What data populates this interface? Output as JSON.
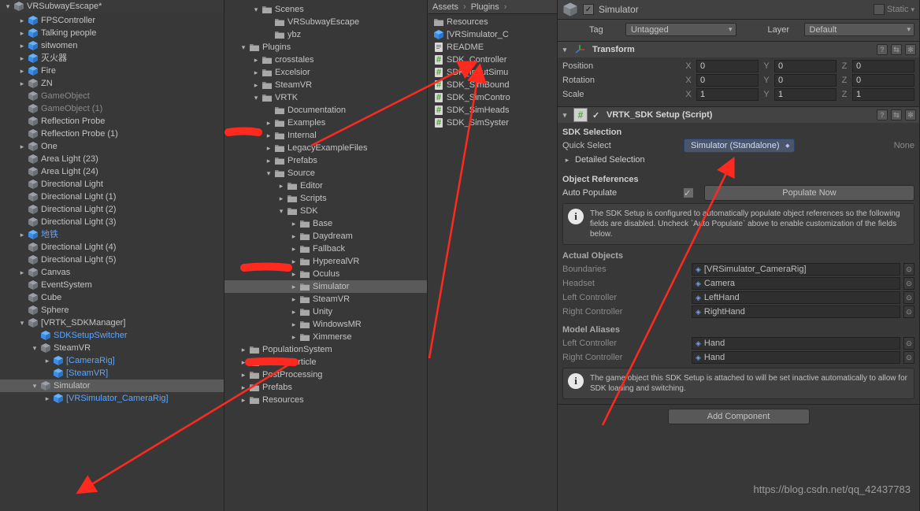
{
  "hierarchy": {
    "scene_name": "VRSubwayEscape*",
    "items": [
      {
        "label": "FPSController",
        "depth": 1,
        "arrow": "collapsed",
        "icon": "cube-blue"
      },
      {
        "label": "Talking people",
        "depth": 1,
        "arrow": "collapsed",
        "icon": "cube-blue"
      },
      {
        "label": "sitwomen",
        "depth": 1,
        "arrow": "collapsed",
        "icon": "cube-blue"
      },
      {
        "label": "灭火器",
        "depth": 1,
        "arrow": "collapsed",
        "icon": "cube-blue"
      },
      {
        "label": "Fire",
        "depth": 1,
        "arrow": "collapsed",
        "icon": "cube-blue"
      },
      {
        "label": "ZN",
        "depth": 1,
        "arrow": "collapsed",
        "icon": "cube"
      },
      {
        "label": "GameObject",
        "depth": 1,
        "arrow": "none",
        "icon": "cube",
        "dim": true
      },
      {
        "label": "GameObject (1)",
        "depth": 1,
        "arrow": "none",
        "icon": "cube",
        "dim": true
      },
      {
        "label": "Reflection Probe",
        "depth": 1,
        "arrow": "none",
        "icon": "cube"
      },
      {
        "label": "Reflection Probe (1)",
        "depth": 1,
        "arrow": "none",
        "icon": "cube"
      },
      {
        "label": "One",
        "depth": 1,
        "arrow": "collapsed",
        "icon": "cube"
      },
      {
        "label": "Area Light (23)",
        "depth": 1,
        "arrow": "none",
        "icon": "cube"
      },
      {
        "label": "Area Light (24)",
        "depth": 1,
        "arrow": "none",
        "icon": "cube"
      },
      {
        "label": "Directional Light",
        "depth": 1,
        "arrow": "none",
        "icon": "cube"
      },
      {
        "label": "Directional Light (1)",
        "depth": 1,
        "arrow": "none",
        "icon": "cube"
      },
      {
        "label": "Directional Light (2)",
        "depth": 1,
        "arrow": "none",
        "icon": "cube"
      },
      {
        "label": "Directional Light (3)",
        "depth": 1,
        "arrow": "none",
        "icon": "cube"
      },
      {
        "label": "地铁",
        "depth": 1,
        "arrow": "collapsed",
        "icon": "cube-blue",
        "blue": true
      },
      {
        "label": "Directional Light (4)",
        "depth": 1,
        "arrow": "none",
        "icon": "cube"
      },
      {
        "label": "Directional Light (5)",
        "depth": 1,
        "arrow": "none",
        "icon": "cube"
      },
      {
        "label": "Canvas",
        "depth": 1,
        "arrow": "collapsed",
        "icon": "cube"
      },
      {
        "label": "EventSystem",
        "depth": 1,
        "arrow": "none",
        "icon": "cube"
      },
      {
        "label": "Cube",
        "depth": 1,
        "arrow": "none",
        "icon": "cube"
      },
      {
        "label": "Sphere",
        "depth": 1,
        "arrow": "none",
        "icon": "cube"
      },
      {
        "label": "[VRTK_SDKManager]",
        "depth": 1,
        "arrow": "open",
        "icon": "cube"
      },
      {
        "label": "SDKSetupSwitcher",
        "depth": 2,
        "arrow": "none",
        "icon": "cube-blue",
        "blue": true
      },
      {
        "label": "SteamVR",
        "depth": 2,
        "arrow": "open",
        "icon": "cube"
      },
      {
        "label": "[CameraRig]",
        "depth": 3,
        "arrow": "collapsed",
        "icon": "cube-blue",
        "blue": true
      },
      {
        "label": "[SteamVR]",
        "depth": 3,
        "arrow": "none",
        "icon": "cube-blue",
        "blue": true
      },
      {
        "label": "Simulator",
        "depth": 2,
        "arrow": "open",
        "icon": "cube",
        "sel": true
      },
      {
        "label": "[VRSimulator_CameraRig]",
        "depth": 3,
        "arrow": "collapsed",
        "icon": "cube-blue",
        "blue": true
      }
    ]
  },
  "project": {
    "root": "Scenes",
    "items": [
      {
        "label": "Scenes",
        "depth": 2,
        "arrow": "open",
        "icon": "folder"
      },
      {
        "label": "VRSubwayEscape",
        "depth": 3,
        "arrow": "none",
        "icon": "folder"
      },
      {
        "label": "ybz",
        "depth": 3,
        "arrow": "none",
        "icon": "folder"
      },
      {
        "label": "Plugins",
        "depth": 1,
        "arrow": "open",
        "icon": "folder"
      },
      {
        "label": "crosstales",
        "depth": 2,
        "arrow": "collapsed",
        "icon": "folder"
      },
      {
        "label": "Excelsior",
        "depth": 2,
        "arrow": "collapsed",
        "icon": "folder"
      },
      {
        "label": "SteamVR",
        "depth": 2,
        "arrow": "collapsed",
        "icon": "folder"
      },
      {
        "label": "VRTK",
        "depth": 2,
        "arrow": "open",
        "icon": "folder"
      },
      {
        "label": "Documentation",
        "depth": 3,
        "arrow": "none",
        "icon": "folder"
      },
      {
        "label": "Examples",
        "depth": 3,
        "arrow": "collapsed",
        "icon": "folder"
      },
      {
        "label": "Internal",
        "depth": 3,
        "arrow": "collapsed",
        "icon": "folder"
      },
      {
        "label": "LegacyExampleFiles",
        "depth": 3,
        "arrow": "collapsed",
        "icon": "folder"
      },
      {
        "label": "Prefabs",
        "depth": 3,
        "arrow": "collapsed",
        "icon": "folder"
      },
      {
        "label": "Source",
        "depth": 3,
        "arrow": "open",
        "icon": "folder"
      },
      {
        "label": "Editor",
        "depth": 4,
        "arrow": "collapsed",
        "icon": "folder"
      },
      {
        "label": "Scripts",
        "depth": 4,
        "arrow": "collapsed",
        "icon": "folder"
      },
      {
        "label": "SDK",
        "depth": 4,
        "arrow": "open",
        "icon": "folder"
      },
      {
        "label": "Base",
        "depth": 5,
        "arrow": "collapsed",
        "icon": "folder"
      },
      {
        "label": "Daydream",
        "depth": 5,
        "arrow": "collapsed",
        "icon": "folder"
      },
      {
        "label": "Fallback",
        "depth": 5,
        "arrow": "collapsed",
        "icon": "folder"
      },
      {
        "label": "HyperealVR",
        "depth": 5,
        "arrow": "collapsed",
        "icon": "folder"
      },
      {
        "label": "Oculus",
        "depth": 5,
        "arrow": "collapsed",
        "icon": "folder"
      },
      {
        "label": "Simulator",
        "depth": 5,
        "arrow": "collapsed",
        "icon": "folder",
        "sel": true
      },
      {
        "label": "SteamVR",
        "depth": 5,
        "arrow": "collapsed",
        "icon": "folder"
      },
      {
        "label": "Unity",
        "depth": 5,
        "arrow": "collapsed",
        "icon": "folder"
      },
      {
        "label": "WindowsMR",
        "depth": 5,
        "arrow": "collapsed",
        "icon": "folder"
      },
      {
        "label": "Ximmerse",
        "depth": 5,
        "arrow": "collapsed",
        "icon": "folder"
      },
      {
        "label": "PopulationSystem",
        "depth": 1,
        "arrow": "collapsed",
        "icon": "folder"
      },
      {
        "label": "Portal Particle",
        "depth": 1,
        "arrow": "collapsed",
        "icon": "folder"
      },
      {
        "label": "PostProcessing",
        "depth": 1,
        "arrow": "collapsed",
        "icon": "folder"
      },
      {
        "label": "Prefabs",
        "depth": 1,
        "arrow": "collapsed",
        "icon": "folder"
      },
      {
        "label": "Resources",
        "depth": 1,
        "arrow": "collapsed",
        "icon": "folder"
      }
    ]
  },
  "assets": {
    "crumb1": "Assets",
    "crumb2": "Plugins",
    "items": [
      {
        "label": "Resources",
        "icon": "folder"
      },
      {
        "label": "[VRSimulator_C",
        "icon": "prefab"
      },
      {
        "label": "README",
        "icon": "text"
      },
      {
        "label": "SDK_Controller",
        "icon": "script"
      },
      {
        "label": "SDK_InputSimu",
        "icon": "script"
      },
      {
        "label": "SDK_SimBound",
        "icon": "script"
      },
      {
        "label": "SDK_SimContro",
        "icon": "script"
      },
      {
        "label": "SDK_SimHeads",
        "icon": "script"
      },
      {
        "label": "SDK_SimSyster",
        "icon": "script"
      }
    ]
  },
  "inspector": {
    "go_name": "Simulator",
    "static_label": "Static",
    "tag_label": "Tag",
    "tag_value": "Untagged",
    "layer_label": "Layer",
    "layer_value": "Default",
    "transform": {
      "title": "Transform",
      "rows": [
        {
          "label": "Position",
          "x": "0",
          "y": "0",
          "z": "0"
        },
        {
          "label": "Rotation",
          "x": "0",
          "y": "0",
          "z": "0"
        },
        {
          "label": "Scale",
          "x": "1",
          "y": "1",
          "z": "1"
        }
      ]
    },
    "sdk": {
      "title": "VRTK_SDK Setup (Script)",
      "sel_title": "SDK Selection",
      "quick": "Quick Select",
      "quick_value": "Simulator (Standalone)",
      "none": "None",
      "detailed": "Detailed Selection",
      "obj_title": "Object References",
      "auto_pop": "Auto Populate",
      "btn_pop": "Populate Now",
      "msg1": "The SDK Setup is configured to automatically populate object references so the following fields are disabled. Uncheck `Auto Populate` above to enable customization of the fields below.",
      "actual": "Actual Objects",
      "rows": [
        {
          "label": "Boundaries",
          "val": "[VRSimulator_CameraRig]"
        },
        {
          "label": "Headset",
          "val": "Camera"
        },
        {
          "label": "Left Controller",
          "val": "LeftHand"
        },
        {
          "label": "Right Controller",
          "val": "RightHand"
        }
      ],
      "aliases": "Model Aliases",
      "arow": [
        {
          "label": "Left Controller",
          "val": "Hand"
        },
        {
          "label": "Right Controller",
          "val": "Hand"
        }
      ],
      "msg2": "The game object this SDK Setup is attached to will be set inactive automatically to allow for SDK loading and switching.",
      "addcomp": "Add Component"
    }
  },
  "watermark": "https://blog.csdn.net/qq_42437783"
}
